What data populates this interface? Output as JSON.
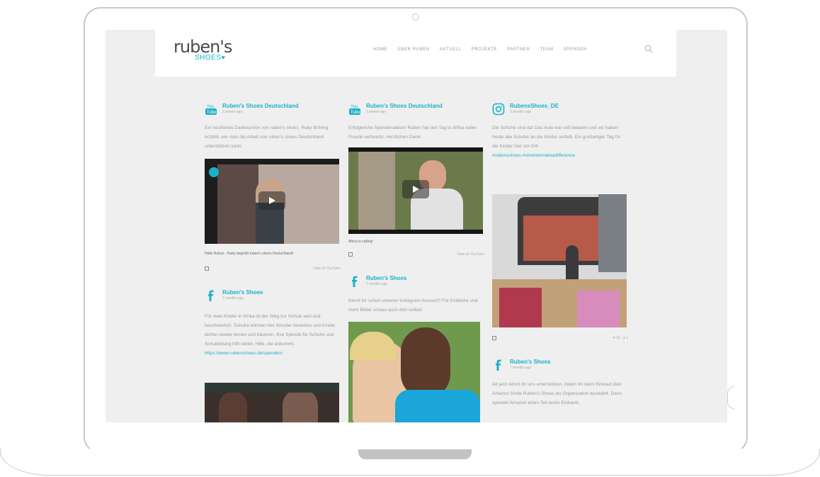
{
  "brand": {
    "logo_word": "ruben's",
    "logo_sub": "SHOES"
  },
  "nav": {
    "items": [
      "HOME",
      "ÜBER RUBEN",
      "AKTUELL",
      "PROJEKTE",
      "PARTNER",
      "TEAM",
      "SPENDEN"
    ]
  },
  "col1": {
    "post1": {
      "name": "Ruben's Shoes Deutschland",
      "time": "2 weeks ago",
      "text": "Ein herzliches Dankeschön von ruben's shoes. Ruby Bröring erzählt, wie man die Arbeit von ruben's shoes Deutschland unterstützen kann.",
      "caption": "Hallo Ruben - Ruby begrüßt ruben's shoes Deutschland!",
      "view": "View on YouTube"
    },
    "post2": {
      "name": "Ruben's Shoes",
      "time": "7 months ago",
      "text": "Für viele Kinder in Afrika ist der Weg zur Schule weit und beschwerlich. Schuhe können hier Wunder bewirken und Kinder dürfen wieder lernen und träumen. Ihre Spende für Schuhe und Schulbildung hilft weiter, Hilfe, die ankommt.",
      "link": "https://www.rubensshoes.de/spenden/"
    }
  },
  "col2": {
    "post1": {
      "name": "Ruben's Shoes Deutschland",
      "time": "2 weeks ago",
      "text": "Erfolgreiche Spendenaktion! Ruben hat den Tag in Afrika voller Freude verbracht. Herzlichen Dank!",
      "caption": "Africa is calling!",
      "view": "View on YouTube"
    },
    "post2": {
      "name": "Ruben's Shoes",
      "time": "7 months ago",
      "text": "Kennt ihr schon unseren Instagram-Account? Für Einblicke und mehr Bilder schaut auch dort vorbei!"
    }
  },
  "col3": {
    "post1": {
      "name": "RubensShoes_DE",
      "time": "3 months ago",
      "text": "Die Schuhe sind da! Das Auto war voll beladen und wir haben heute alle Schuhe an die Kinder verteilt. Ein großartiger Tag für die Kinder hier vor Ort!",
      "tags": "#rubensshoes #shoestomakeadifference",
      "likes": "♥ 10",
      "comments": "● 1"
    },
    "post2": {
      "name": "Ruben's Shoes",
      "time": "7 months ago",
      "text": "Ab jetzt könnt ihr uns unterstützen, indem ihr beim Einkauf über Amazon Smile Ruben's Shoes als Organisation auswählt. Dann spendet Amazon einen Teil eures Einkaufs."
    }
  },
  "colors": {
    "accent": "#1ab2c9",
    "screen_bg": "#efefef",
    "text": "#9a9a9a"
  }
}
